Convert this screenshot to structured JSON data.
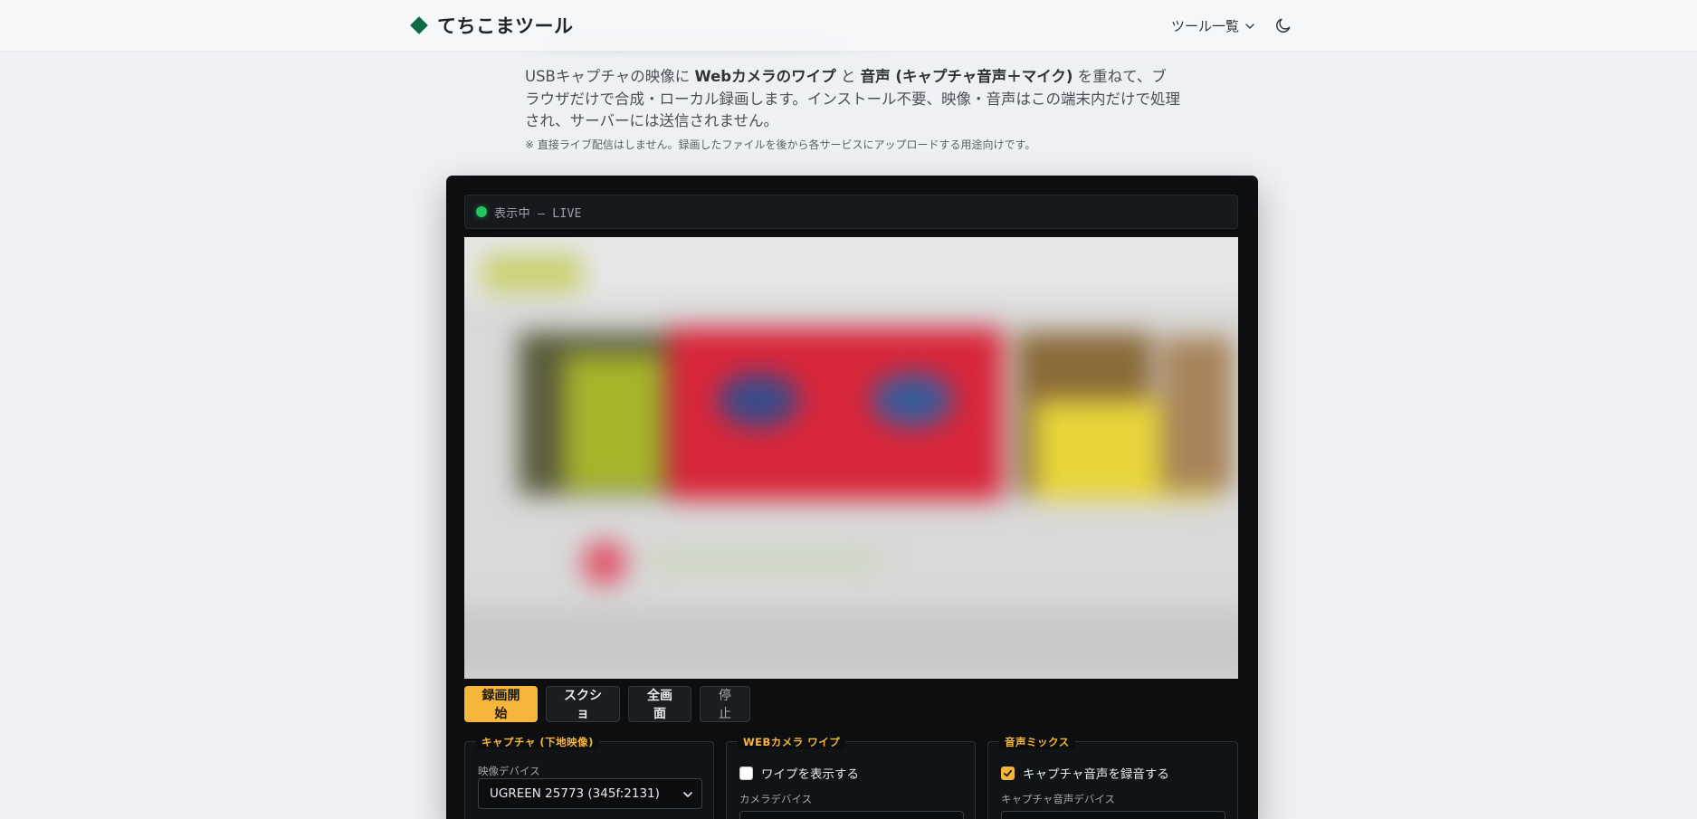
{
  "header": {
    "brand_name": "てちこまツール",
    "tools_menu_label": "ツール一覧",
    "theme_icon": "moon-icon"
  },
  "intro": {
    "description_parts": [
      "USBキャプチャの映像に ",
      "Webカメラのワイプ",
      " と ",
      "音声 (キャプチャ音声＋マイク)",
      " を重ねて、ブラウザだけで合成・ローカル録画します。インストール不要、映像・音声はこの端末内だけで処理され、サーバーには送信されません。"
    ],
    "note": "※ 直接ライブ配信はしません。録画したファイルを後から各サービスにアップロードする用途向けです。"
  },
  "status": {
    "text": "表示中 — LIVE",
    "color": "#22c55e"
  },
  "controls": {
    "record_label": "録画開始",
    "screenshot_label": "スクショ",
    "fullscreen_label": "全画面",
    "stop_label": "停止"
  },
  "capture_panel": {
    "legend": "キャプチャ (下地映像)",
    "device_label": "映像デバイス",
    "device_value": "UGREEN 25773 (345f:2131)"
  },
  "webcam_panel": {
    "legend": "WEBカメラ ワイプ",
    "show_wipe_label": "ワイプを表示する",
    "show_wipe_checked": false,
    "device_label": "カメラデバイス"
  },
  "audio_panel": {
    "legend": "音声ミックス",
    "record_capture_audio_label": "キャプチャ音声を録音する",
    "record_capture_audio_checked": true,
    "device_label": "キャプチャ音声デバイス"
  },
  "colors": {
    "accent": "#f6b53b",
    "brand": "#0f6b47",
    "panel_bg": "#0c0e10"
  }
}
